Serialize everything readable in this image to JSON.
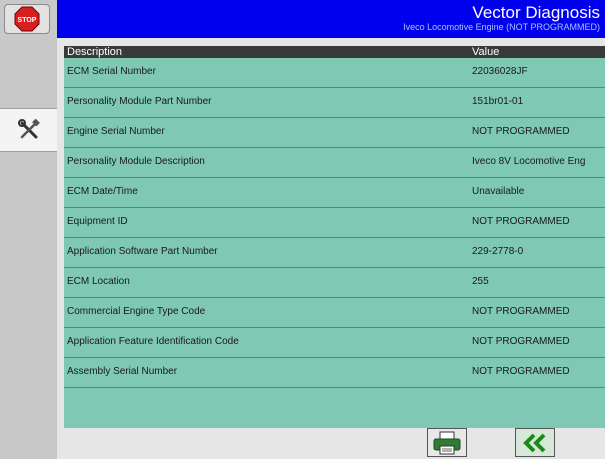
{
  "header": {
    "title": "Vector Diagnosis",
    "subtitle": "Iveco Locomotive Engine (NOT PROGRAMMED)",
    "background_color": "#0000ee"
  },
  "sidebar": {
    "stop_button": {
      "label": "STOP",
      "icon": "stop-sign-icon",
      "color": "#d42020"
    },
    "tools_button": {
      "icon": "tools-icon"
    }
  },
  "table": {
    "columns": [
      "Description",
      "Value"
    ],
    "rows": [
      [
        "ECM Serial Number",
        "22036028JF"
      ],
      [
        "Personality Module Part Number",
        "151br01-01"
      ],
      [
        "Engine Serial Number",
        "NOT PROGRAMMED"
      ],
      [
        "Personality Module Description",
        "Iveco 8V Locomotive Eng"
      ],
      [
        "ECM Date/Time",
        "Unavailable"
      ],
      [
        "Equipment ID",
        "NOT PROGRAMMED"
      ],
      [
        "Application Software Part Number",
        "229-2778-0"
      ],
      [
        "ECM Location",
        "255"
      ],
      [
        "Commercial Engine Type Code",
        "NOT PROGRAMMED"
      ],
      [
        "Application Feature Identification Code",
        "NOT PROGRAMMED"
      ],
      [
        "Assembly Serial Number",
        "NOT PROGRAMMED"
      ]
    ],
    "row_color": "#7ec8b4",
    "header_color": "#3a3a3a"
  },
  "footer": {
    "print_button": {
      "icon": "printer-icon"
    },
    "back_button": {
      "icon": "double-chevron-left-icon",
      "color": "#1a8a1a"
    }
  }
}
